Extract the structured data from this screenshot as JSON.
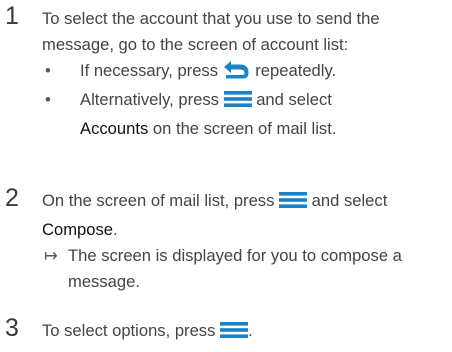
{
  "icons": {
    "back": "back-arrow-icon",
    "menu": "menu-icon",
    "accent_color": "#1a82c6"
  },
  "steps": [
    {
      "number": "1",
      "text": "To select the account that you use to send the message, go to the screen of account list:",
      "bullets": [
        {
          "mark": "•",
          "before": "If necessary, press",
          "after": "repeatedly."
        },
        {
          "mark": "•",
          "before": "Alternatively, press",
          "middle": "and select",
          "bold": "Accounts",
          "after": "on the screen of mail list."
        }
      ]
    },
    {
      "number": "2",
      "before": "On the screen of mail list, press",
      "middle": "and select",
      "bold": "Compose",
      "after": ".",
      "result_mark": "↦",
      "result_text": "The screen is displayed for you to compose a message."
    },
    {
      "number": "3",
      "before": "To select options, press",
      "after": "."
    }
  ]
}
